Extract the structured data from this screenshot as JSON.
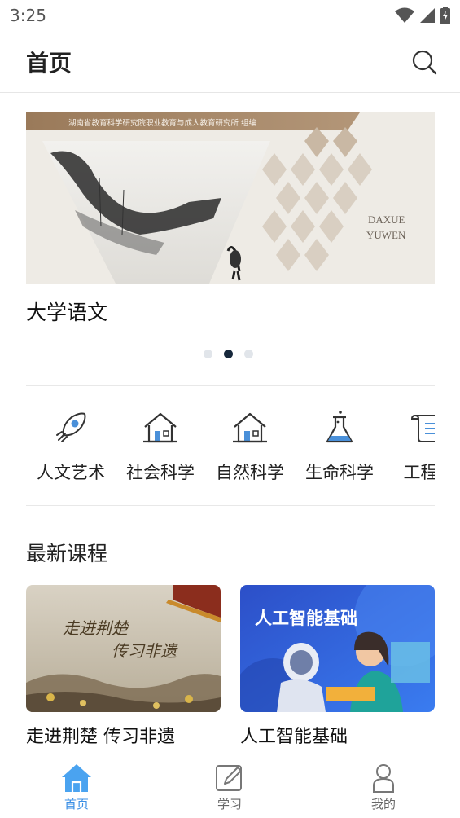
{
  "status_bar": {
    "time": "3:25"
  },
  "header": {
    "title": "首页"
  },
  "banner": {
    "publisher_text": "湖南省教育科学研究院职业教育与成人教育研究所  组编",
    "cover_text_line1": "DAXUE",
    "cover_text_line2": "YUWEN",
    "caption": "大学语文",
    "dots_count": 3,
    "active_dot": 2
  },
  "categories": [
    {
      "label": "人文艺术",
      "icon": "rocket-icon"
    },
    {
      "label": "社会科学",
      "icon": "house-icon"
    },
    {
      "label": "自然科学",
      "icon": "house-icon"
    },
    {
      "label": "生命科学",
      "icon": "flask-icon"
    },
    {
      "label": "工程科",
      "icon": "scroll-icon"
    }
  ],
  "latest": {
    "title": "最新课程",
    "courses": [
      {
        "title": "走进荆楚 传习非遗",
        "thumb_text1": "走进荆楚",
        "thumb_text2": "传习非遗"
      },
      {
        "title": "人工智能基础",
        "thumb_text": "人工智能基础"
      }
    ]
  },
  "tabbar": {
    "items": [
      {
        "label": "首页",
        "icon": "home-icon",
        "active": true
      },
      {
        "label": "学习",
        "icon": "edit-icon",
        "active": false
      },
      {
        "label": "我的",
        "icon": "user-icon",
        "active": false
      }
    ],
    "active_color": "#3b8fe5",
    "inactive_color": "#666666"
  }
}
